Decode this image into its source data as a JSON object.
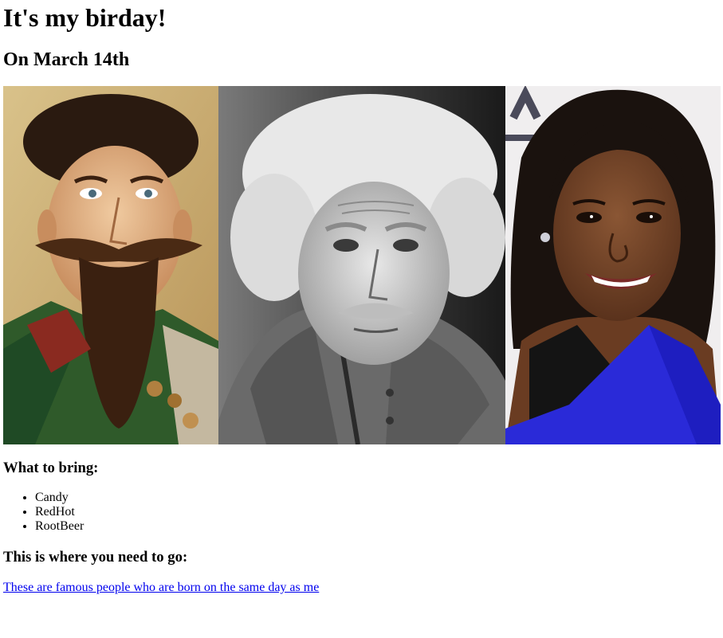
{
  "header": {
    "title": "It's my birday!",
    "subtitle": "On March 14th"
  },
  "photos": [
    {
      "icon": "portrait-bearded-man-painting"
    },
    {
      "icon": "portrait-white-haired-man-bw"
    },
    {
      "icon": "portrait-smiling-woman"
    }
  ],
  "bring": {
    "heading": "What to bring:",
    "items": [
      "Candy",
      "RedHot",
      "RootBeer"
    ]
  },
  "directions": {
    "heading": "This is where you need to go:",
    "link_text": "These are famous people who are born on the same day as me"
  },
  "colors": {
    "link": "#0000ee",
    "text": "#000000",
    "background": "#ffffff"
  }
}
